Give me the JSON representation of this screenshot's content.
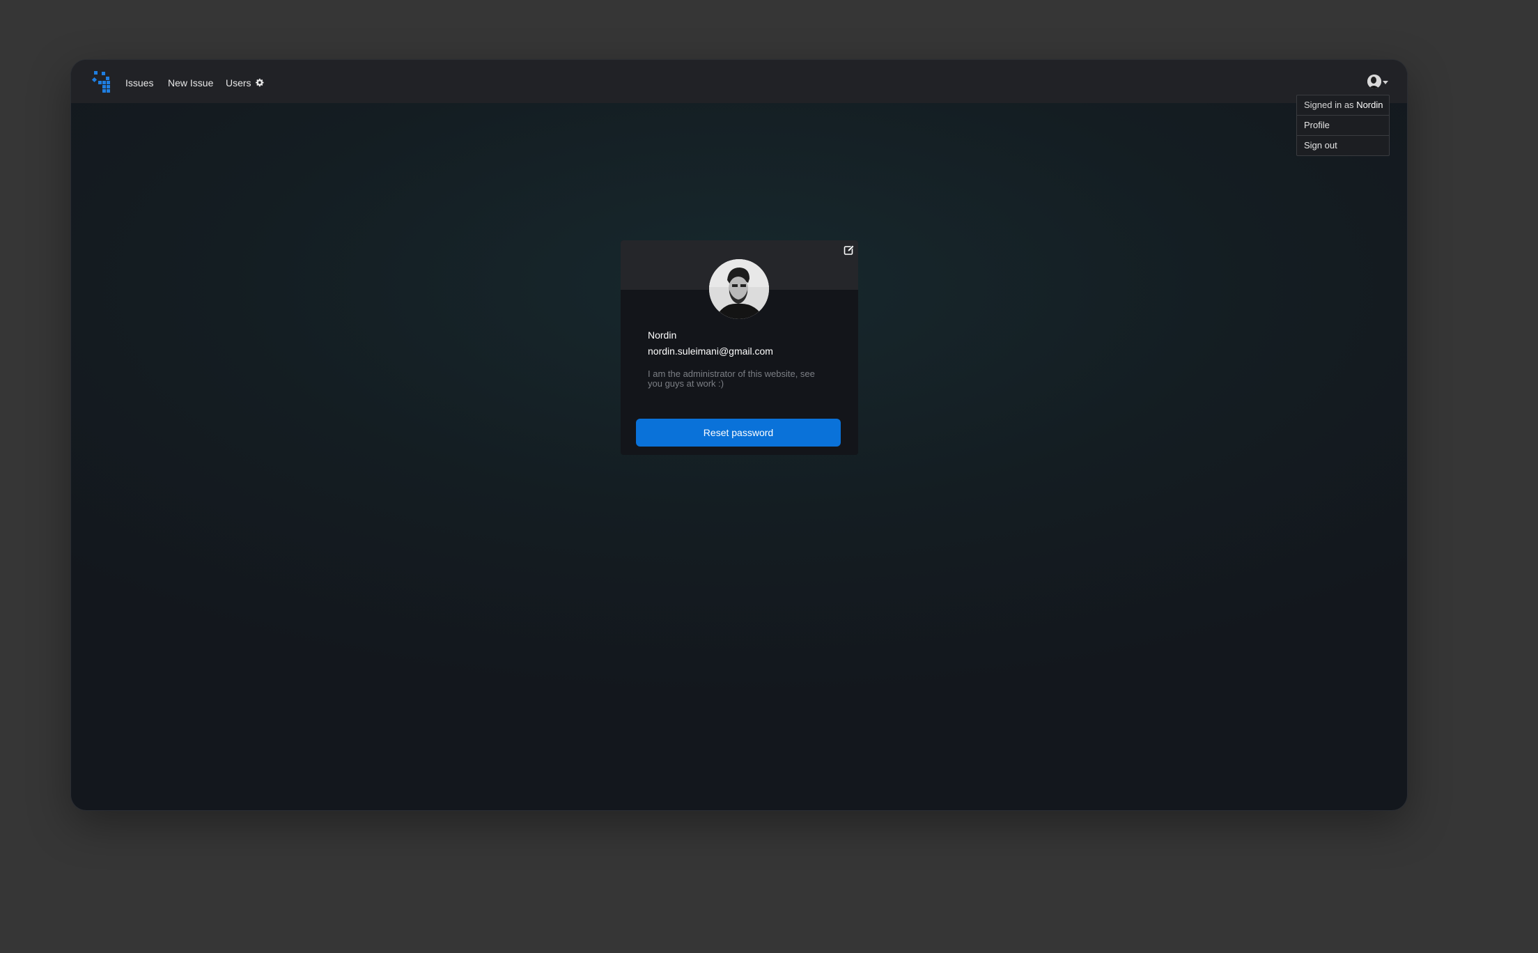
{
  "nav": {
    "issues_label": "Issues",
    "new_issue_label": "New Issue",
    "users_label": "Users"
  },
  "user_menu": {
    "signed_in_prefix": "Signed in as",
    "signed_in_user": "Nordin",
    "profile_label": "Profile",
    "sign_out_label": "Sign out"
  },
  "profile": {
    "name": "Nordin",
    "email": "nordin.suleimani@gmail.com",
    "bio": "I am the administrator of this website, see you guys at work :)",
    "reset_password_label": "Reset password"
  },
  "icons": {
    "logo": "blue-square-grid-logo",
    "users": "gear-icon",
    "edit": "edit-icon",
    "menu_caret": "caret-down-icon"
  },
  "colors": {
    "accent": "#0a72d9",
    "navbar": "#212226",
    "card": "#13151a",
    "card_header": "#25262a"
  }
}
